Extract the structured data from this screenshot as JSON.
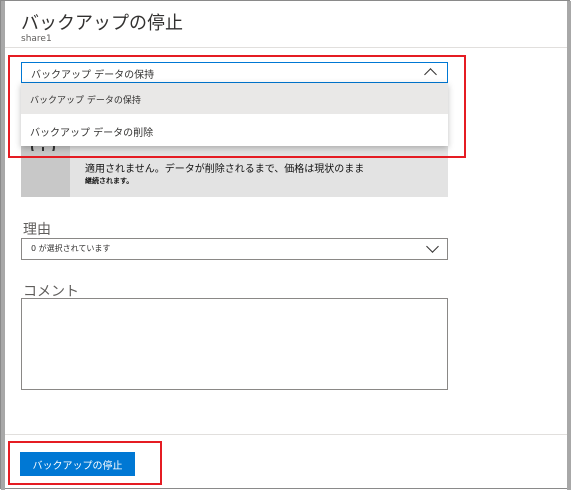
{
  "header": {
    "title": "バックアップの停止",
    "subtitle": "share1"
  },
  "retain_dropdown": {
    "selected": "バックアップ データの保持",
    "options": [
      "バックアップ データの保持",
      "バックアップ データの削除"
    ],
    "expanded": true
  },
  "info_box": {
    "line1": "適用されません。データが削除されるまで、価格は現状のまま",
    "line2": "継続されます。"
  },
  "reason": {
    "label": "理由",
    "placeholder": "0 が選択されています"
  },
  "comment": {
    "label": "コメント",
    "value": ""
  },
  "footer": {
    "stop_button_label": "バックアップの停止",
    "button_color": "#0078d4"
  },
  "colors": {
    "highlight": "#e51c23",
    "accent": "#0078d4"
  }
}
